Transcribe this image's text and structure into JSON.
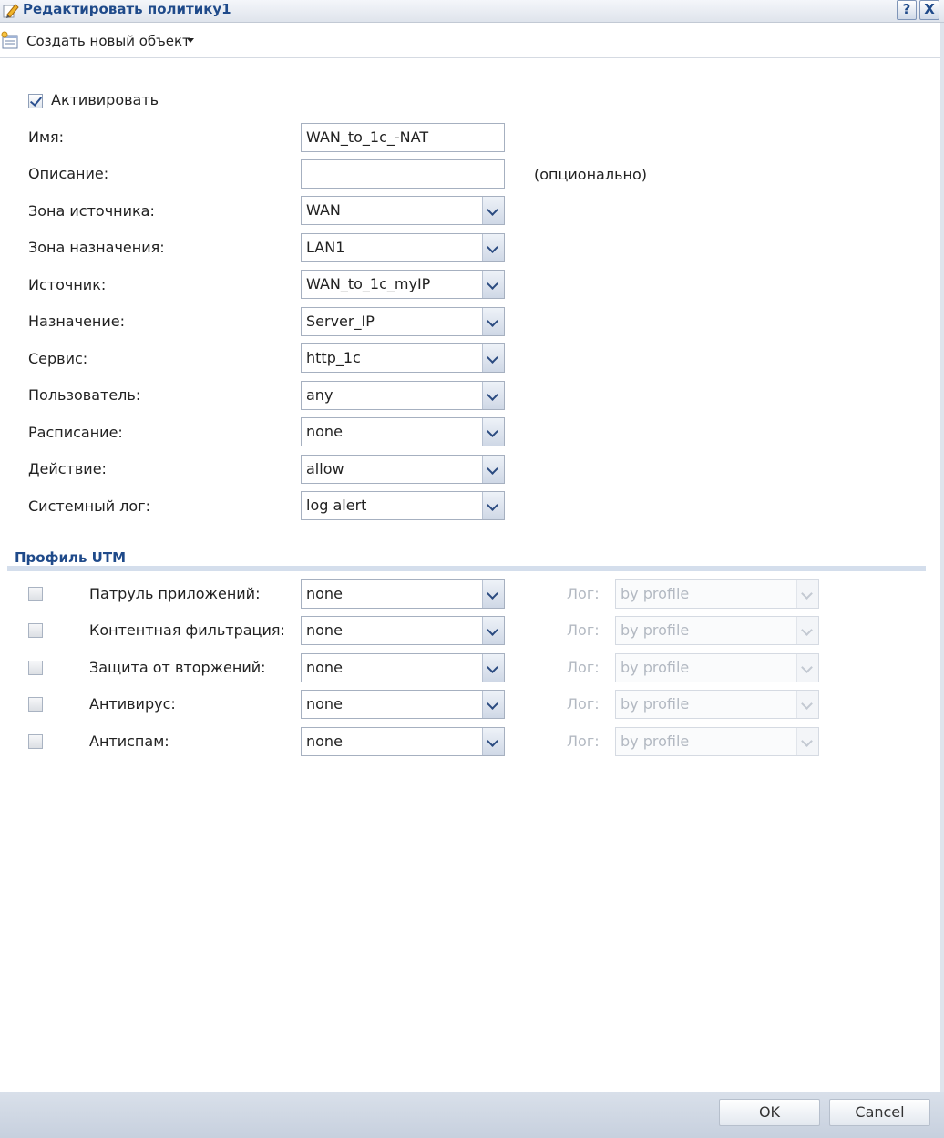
{
  "window": {
    "title": "Редактировать политику1",
    "help_label": "?",
    "close_label": "X"
  },
  "toolbar": {
    "create_label": "Создать новый объект"
  },
  "form": {
    "activate_label": "Активировать",
    "activate_checked": true,
    "name": {
      "label": "Имя:",
      "value": "WAN_to_1c_-NAT"
    },
    "description": {
      "label": "Описание:",
      "value": "",
      "hint": "(опционально)"
    },
    "source_zone": {
      "label": "Зона источника:",
      "value": "WAN"
    },
    "dest_zone": {
      "label": "Зона назначения:",
      "value": "LAN1"
    },
    "source": {
      "label": "Источник:",
      "value": "WAN_to_1c_myIP"
    },
    "destination": {
      "label": "Назначение:",
      "value": "Server_IP"
    },
    "service": {
      "label": "Сервис:",
      "value": "http_1c"
    },
    "user": {
      "label": "Пользователь:",
      "value": "any"
    },
    "schedule": {
      "label": "Расписание:",
      "value": "none"
    },
    "action": {
      "label": "Действие:",
      "value": "allow"
    },
    "syslog": {
      "label": "Системный лог:",
      "value": "log alert"
    }
  },
  "utm": {
    "title": "Профиль UTM",
    "log_label": "Лог:",
    "rows": [
      {
        "label": "Патруль приложений:",
        "checked": false,
        "profile": "none",
        "log": "by profile"
      },
      {
        "label": "Контентная фильтрация:",
        "checked": false,
        "profile": "none",
        "log": "by profile"
      },
      {
        "label": "Защита от вторжений:",
        "checked": false,
        "profile": "none",
        "log": "by profile"
      },
      {
        "label": "Антивирус:",
        "checked": false,
        "profile": "none",
        "log": "by profile"
      },
      {
        "label": "Антиспам:",
        "checked": false,
        "profile": "none",
        "log": "by profile"
      }
    ]
  },
  "footer": {
    "ok_label": "OK",
    "cancel_label": "Cancel"
  }
}
